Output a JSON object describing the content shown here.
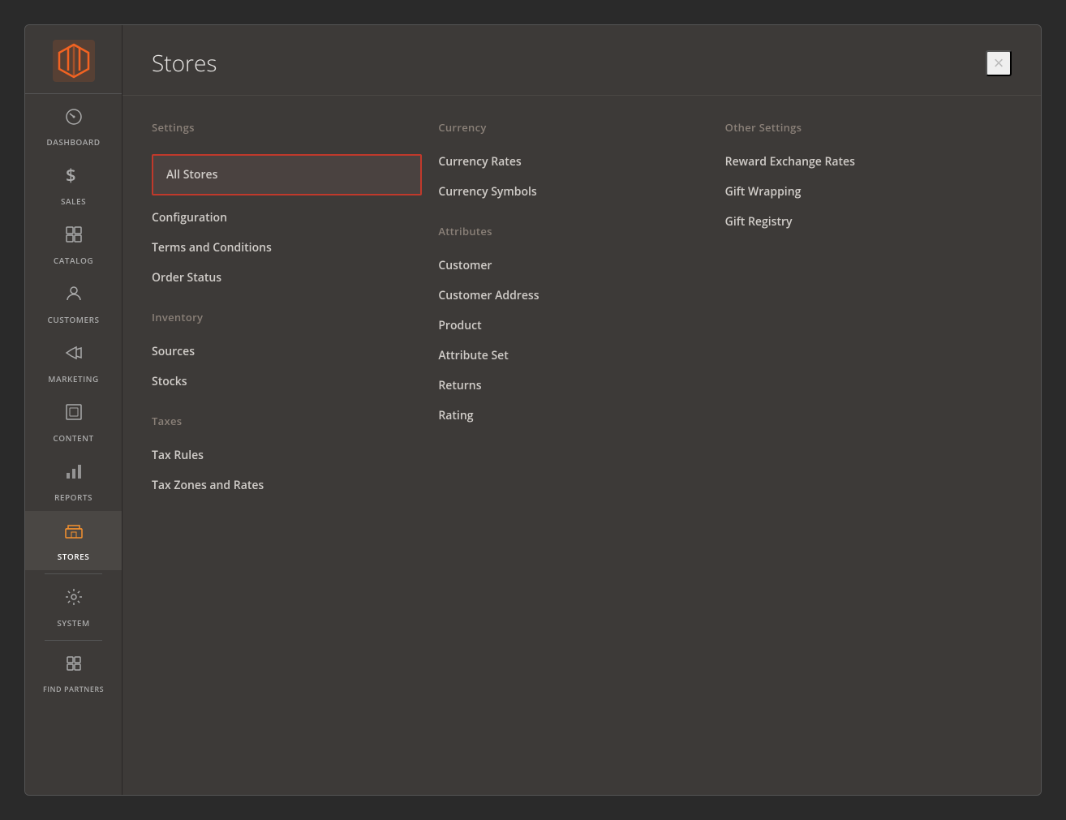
{
  "sidebar": {
    "items": [
      {
        "id": "dashboard",
        "label": "DASHBOARD",
        "icon": "🖥",
        "active": false
      },
      {
        "id": "sales",
        "label": "SALES",
        "icon": "$",
        "active": false
      },
      {
        "id": "catalog",
        "label": "CATALOG",
        "icon": "📦",
        "active": false
      },
      {
        "id": "customers",
        "label": "CUSTOMERS",
        "icon": "👤",
        "active": false
      },
      {
        "id": "marketing",
        "label": "MARKETING",
        "icon": "📣",
        "active": false
      },
      {
        "id": "content",
        "label": "CONTENT",
        "icon": "▣",
        "active": false
      },
      {
        "id": "reports",
        "label": "REPORTS",
        "icon": "📊",
        "active": false
      },
      {
        "id": "stores",
        "label": "STORES",
        "icon": "🏪",
        "active": true
      },
      {
        "id": "system",
        "label": "SYSTEM",
        "icon": "⚙",
        "active": false
      },
      {
        "id": "find-partners",
        "label": "FIND PARTNERS",
        "icon": "❖",
        "active": false
      }
    ]
  },
  "panel": {
    "title": "Stores",
    "close_label": "×"
  },
  "columns": {
    "settings": {
      "section_title": "Settings",
      "items": [
        {
          "id": "all-stores",
          "label": "All Stores",
          "highlighted": true
        },
        {
          "id": "configuration",
          "label": "Configuration",
          "highlighted": false
        },
        {
          "id": "terms-and-conditions",
          "label": "Terms and Conditions",
          "highlighted": false
        },
        {
          "id": "order-status",
          "label": "Order Status",
          "highlighted": false
        }
      ]
    },
    "inventory": {
      "section_title": "Inventory",
      "items": [
        {
          "id": "sources",
          "label": "Sources",
          "highlighted": false
        },
        {
          "id": "stocks",
          "label": "Stocks",
          "highlighted": false
        }
      ]
    },
    "taxes": {
      "section_title": "Taxes",
      "items": [
        {
          "id": "tax-rules",
          "label": "Tax Rules",
          "highlighted": false
        },
        {
          "id": "tax-zones-and-rates",
          "label": "Tax Zones and Rates",
          "highlighted": false
        }
      ]
    },
    "currency": {
      "section_title": "Currency",
      "items": [
        {
          "id": "currency-rates",
          "label": "Currency Rates",
          "highlighted": false
        },
        {
          "id": "currency-symbols",
          "label": "Currency Symbols",
          "highlighted": false
        }
      ]
    },
    "attributes": {
      "section_title": "Attributes",
      "items": [
        {
          "id": "customer",
          "label": "Customer",
          "highlighted": false
        },
        {
          "id": "customer-address",
          "label": "Customer Address",
          "highlighted": false
        },
        {
          "id": "product",
          "label": "Product",
          "highlighted": false
        },
        {
          "id": "attribute-set",
          "label": "Attribute Set",
          "highlighted": false
        },
        {
          "id": "returns",
          "label": "Returns",
          "highlighted": false
        },
        {
          "id": "rating",
          "label": "Rating",
          "highlighted": false
        }
      ]
    },
    "other_settings": {
      "section_title": "Other Settings",
      "items": [
        {
          "id": "reward-exchange-rates",
          "label": "Reward Exchange Rates",
          "highlighted": false
        },
        {
          "id": "gift-wrapping",
          "label": "Gift Wrapping",
          "highlighted": false
        },
        {
          "id": "gift-registry",
          "label": "Gift Registry",
          "highlighted": false
        }
      ]
    }
  }
}
